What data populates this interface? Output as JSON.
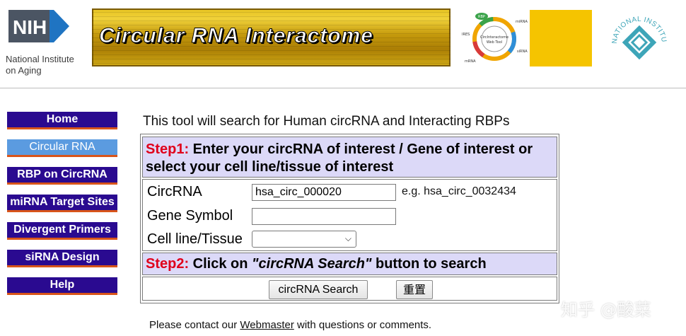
{
  "header": {
    "nih_logo": {
      "mark": "NIH",
      "subtitle": "National Institute\non Aging"
    },
    "banner_title": "Circular RNA Interactome",
    "wheel": {
      "center_line1": "CircInteractome",
      "center_line2": "Web Tool",
      "labels": [
        "RBP",
        "IRES",
        "miRNA",
        "siRNA",
        "mRNA"
      ]
    },
    "seal_text": "NATIONAL INSTITUTES OF HEALTH"
  },
  "nav": {
    "items": [
      {
        "label": "Home",
        "active": false
      },
      {
        "label": "Circular RNA",
        "active": true
      },
      {
        "label": "RBP on CircRNA",
        "active": false
      },
      {
        "label": "miRNA Target Sites",
        "active": false
      },
      {
        "label": "Divergent Primers",
        "active": false
      },
      {
        "label": "siRNA Design",
        "active": false
      },
      {
        "label": "Help",
        "active": false
      }
    ],
    "colors": {
      "button": "#2a0a90",
      "active": "#5b9be0",
      "underline": "#d9551a"
    }
  },
  "main": {
    "intro": "This tool will search for Human circRNA and Interacting RBPs",
    "step1": {
      "prefix": "Step1:",
      "text": " Enter your circRNA of interest / Gene of interest or select your cell line/tissue of interest"
    },
    "fields": {
      "circrna": {
        "label": "CircRNA",
        "value": "hsa_circ_000020",
        "example": "e.g. hsa_circ_0032434"
      },
      "gene": {
        "label": "Gene Symbol",
        "value": ""
      },
      "cell": {
        "label": "Cell line/Tissue",
        "selected": ""
      }
    },
    "step2": {
      "prefix": "Step2:",
      "pre": " Click on ",
      "em": "\"circRNA Search\"",
      "post": " button to search"
    },
    "buttons": {
      "search": "circRNA Search",
      "reset": "重置"
    }
  },
  "footer": {
    "pre": "Please contact our ",
    "link": "Webmaster",
    "post": " with questions or comments."
  },
  "watermark": "知乎 @酸菜",
  "colors": {
    "step_bg": "#dcd9f8",
    "step_prefix": "#e0001b",
    "banner_gold": "#c59a0c"
  }
}
